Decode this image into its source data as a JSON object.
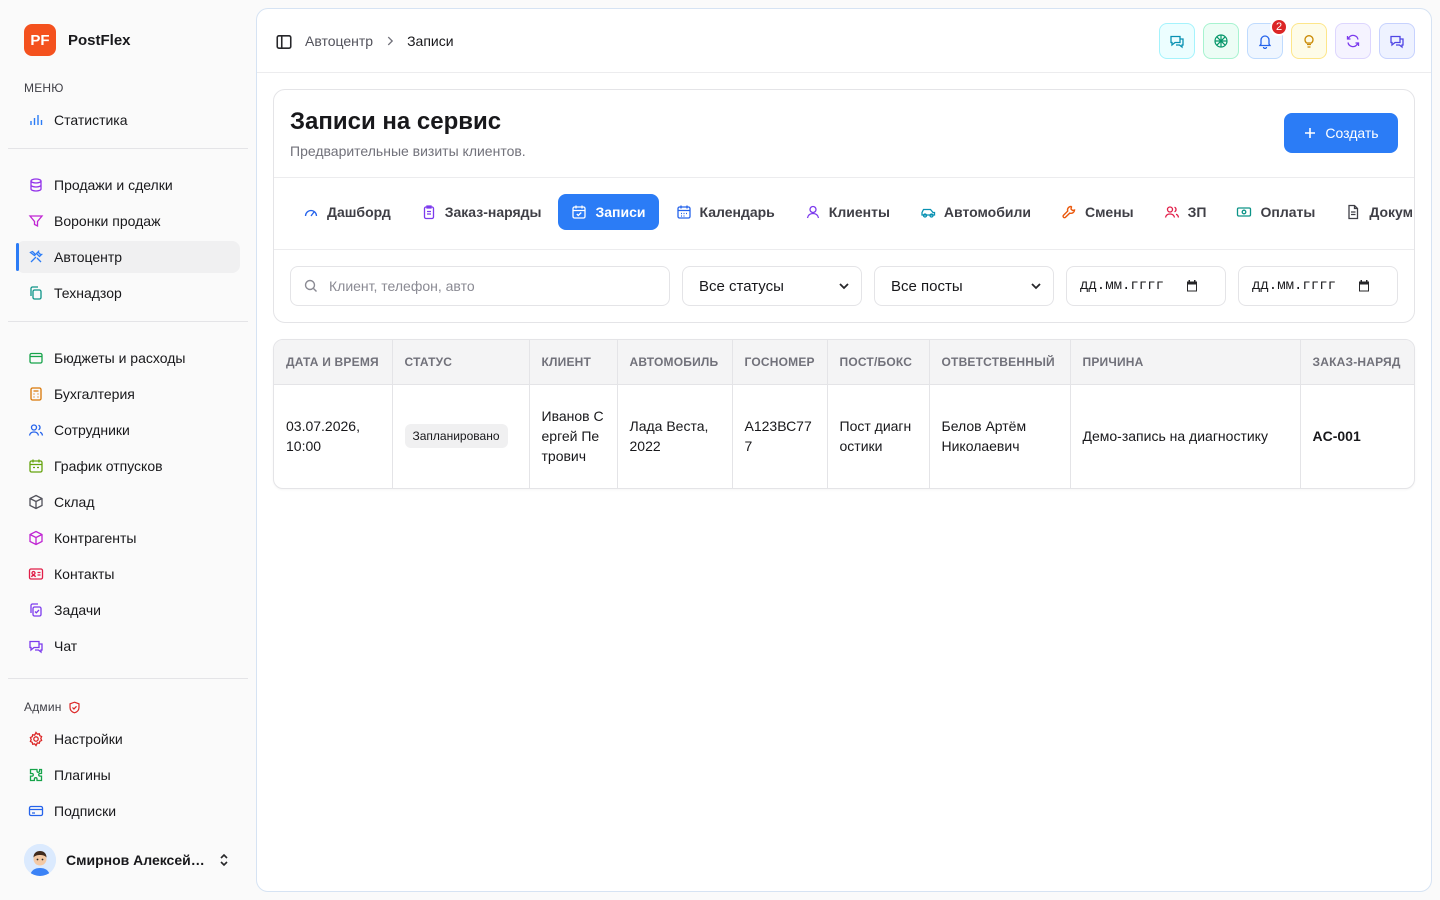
{
  "brand": {
    "logo_text": "PF",
    "name": "PostFlex",
    "logo_color": "#f4511e"
  },
  "sidebar": {
    "menu_heading": "МЕНЮ",
    "group1": [
      {
        "label": "Статистика",
        "icon": "bar-chart-icon"
      }
    ],
    "group2": [
      {
        "label": "Продажи и сделки",
        "icon": "database-icon"
      },
      {
        "label": "Воронки продаж",
        "icon": "funnel-icon"
      },
      {
        "label": "Автоцентр",
        "icon": "tools-icon",
        "active": true
      },
      {
        "label": "Технадзор",
        "icon": "copy-icon"
      }
    ],
    "group3": [
      {
        "label": "Бюджеты и расходы",
        "icon": "wallet-icon"
      },
      {
        "label": "Бухгалтерия",
        "icon": "calculator-icon"
      },
      {
        "label": "Сотрудники",
        "icon": "users-icon"
      },
      {
        "label": "График отпусков",
        "icon": "calendar-icon"
      },
      {
        "label": "Склад",
        "icon": "box-icon"
      },
      {
        "label": "Контрагенты",
        "icon": "package-icon"
      },
      {
        "label": "Контакты",
        "icon": "contact-card-icon"
      },
      {
        "label": "Задачи",
        "icon": "tasks-icon"
      },
      {
        "label": "Чат",
        "icon": "chat-icon"
      }
    ],
    "admin_heading": "Админ",
    "admin": [
      {
        "label": "Настройки",
        "icon": "gear-icon"
      },
      {
        "label": "Плагины",
        "icon": "puzzle-icon"
      },
      {
        "label": "Подписки",
        "icon": "credit-card-icon"
      }
    ],
    "user": {
      "name": "Смирнов Алексей ..."
    }
  },
  "breadcrumb": {
    "parent": "Автоцентр",
    "current": "Записи"
  },
  "topbar": {
    "notifications_count": "2"
  },
  "header": {
    "title": "Записи на сервис",
    "subtitle": "Предварительные визиты клиентов.",
    "create_label": "Создать"
  },
  "tabs": [
    {
      "label": "Дашборд",
      "icon": "gauge-icon"
    },
    {
      "label": "Заказ-наряды",
      "icon": "clipboard-icon"
    },
    {
      "label": "Записи",
      "icon": "calendar-check-icon",
      "active": true
    },
    {
      "label": "Календарь",
      "icon": "calendar-icon"
    },
    {
      "label": "Клиенты",
      "icon": "user-icon"
    },
    {
      "label": "Автомобили",
      "icon": "car-icon"
    },
    {
      "label": "Смены",
      "icon": "wrench-icon"
    },
    {
      "label": "ЗП",
      "icon": "users-icon"
    },
    {
      "label": "Оплаты",
      "icon": "banknote-icon"
    },
    {
      "label": "Докум",
      "icon": "document-icon"
    }
  ],
  "filters": {
    "search_placeholder": "Клиент, телефон, авто",
    "status_select": "Все статусы",
    "post_select": "Все посты",
    "date_from": "дд.мм.гггг",
    "date_to": "дд.мм.гггг"
  },
  "table": {
    "columns": [
      "ДАТА И ВРЕМЯ",
      "СТАТУС",
      "КЛИЕНТ",
      "АВТОМОБИЛЬ",
      "ГОСНОМЕР",
      "ПОСТ/БОКС",
      "ОТВЕТСТВЕННЫЙ",
      "ПРИЧИНА",
      "ЗАКАЗ-НАРЯД"
    ],
    "rows": [
      {
        "datetime": "03.07.2026, 10:00",
        "status": "Запланировано",
        "client": "Иванов Сергей Петрович",
        "car": "Лада Веста, 2022",
        "plate": "А123ВС777",
        "post": "Пост диагностики",
        "responsible": "Белов Артём Николаевич",
        "reason": "Демо-запись на диагностику",
        "order": "AC-001"
      }
    ]
  },
  "colors": {
    "accent": "#2b7cf6",
    "badge": "#dc2626"
  }
}
